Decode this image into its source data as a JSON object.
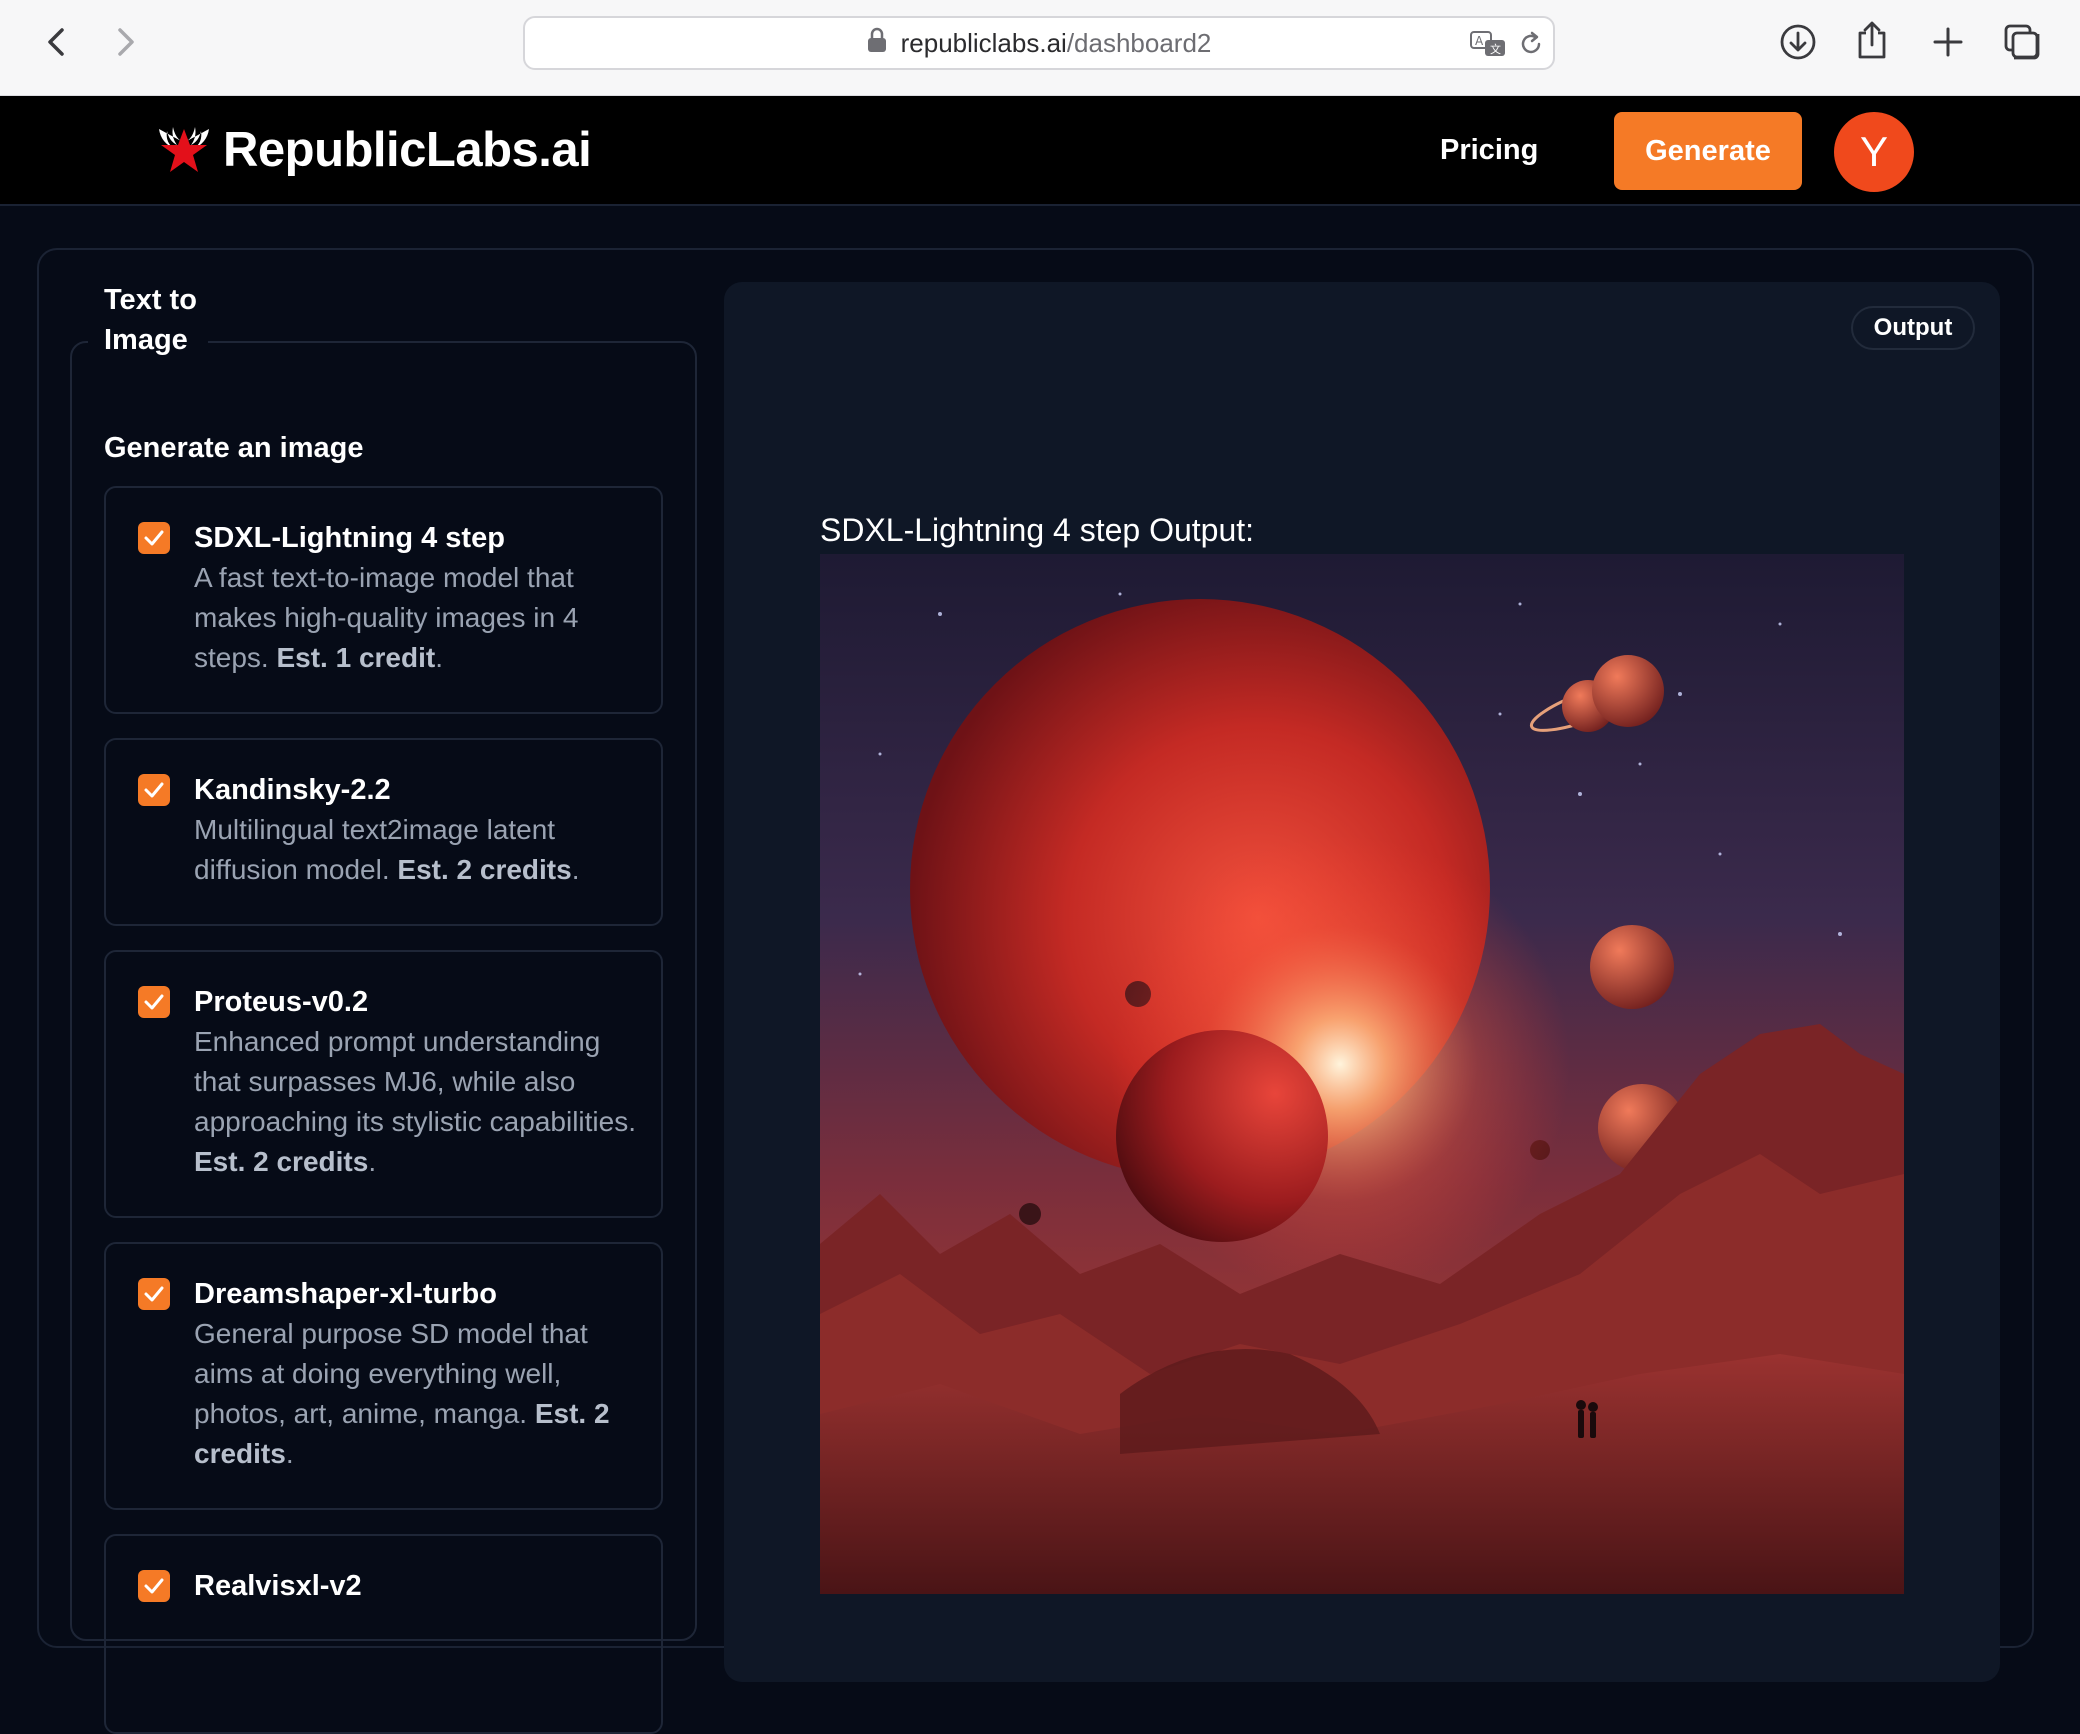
{
  "browser": {
    "url_domain": "republiclabs.ai",
    "url_path": "/dashboard2",
    "icons": [
      "back-arrow-icon",
      "forward-arrow-icon",
      "lock-icon",
      "translate-icon",
      "reload-icon",
      "download-icon",
      "share-icon",
      "new-tab-plus-icon",
      "tab-overview-icon"
    ]
  },
  "header": {
    "logo_text": "RepublicLabs.ai",
    "logo_icon": "winged-star-icon",
    "pricing_label": "Pricing",
    "generate_label": "Generate",
    "avatar_initial": "Y"
  },
  "sidebar": {
    "legend": "Text to Image",
    "subtitle": "Generate an image",
    "models": [
      {
        "name": "SDXL-Lightning 4 step",
        "desc": "A fast text-to-image model that makes high-quality images in 4 steps.",
        "credit": "Est. 1 credit",
        "checked": true
      },
      {
        "name": "Kandinsky-2.2",
        "desc": "Multilingual text2image latent diffusion model.",
        "credit": "Est. 2 credits",
        "checked": true
      },
      {
        "name": "Proteus-v0.2",
        "desc": "Enhanced prompt understanding that surpasses MJ6, while also approaching its stylistic capabilities.",
        "credit": "Est. 2 credits",
        "checked": true
      },
      {
        "name": "Dreamshaper-xl-turbo",
        "desc": "General purpose SD model that aims at doing everything well, photos, art, anime, manga.",
        "credit": "Est. 2 credits",
        "checked": true
      },
      {
        "name": "Realvisxl-v2",
        "desc": "",
        "credit": "",
        "checked": true
      }
    ]
  },
  "output": {
    "badge": "Output",
    "label": "SDXL-Lightning 4 step Output:"
  },
  "colors": {
    "accent": "#f57a26",
    "avatar": "#f0491c",
    "background": "#060b17",
    "panel": "#0f1726"
  }
}
